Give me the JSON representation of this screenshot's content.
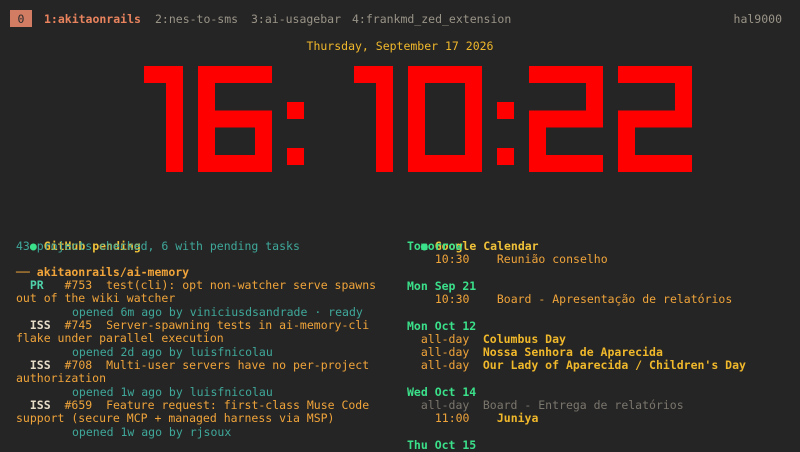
{
  "tmux": {
    "tabs": [
      {
        "label": "0"
      },
      {
        "label": "1:akitaonrails"
      },
      {
        "label": "2:nes-to-sms"
      },
      {
        "label": "3:ai-usagebar"
      },
      {
        "label": "4:frankmd_zed_extension"
      }
    ],
    "hostname": "hal9000"
  },
  "date_line": "Thursday, September 17 2026",
  "clock": {
    "text": "16:10:22",
    "color": "#ff0000"
  },
  "github": {
    "dot": "●",
    "title": "GitHub pending",
    "summary": "43 projects checked, 6 with pending tasks",
    "repo": "── akitaonrails/ai-memory",
    "items": [
      {
        "kind": "PR",
        "number": "#753",
        "title_1": "test(cli): opt non-watcher serve spawns",
        "title_2": "out of the wiki watcher",
        "meta": "opened 6m ago by viniciusdsandrade · ready"
      },
      {
        "kind": "ISS",
        "number": "#745",
        "title_1": "Server-spawning tests in ai-memory-cli",
        "title_2": "flake under parallel execution",
        "meta": "opened 2d ago by luisfnicolau"
      },
      {
        "kind": "ISS",
        "number": "#708",
        "title_1": "Multi-user servers have no per-project",
        "title_2": "authorization",
        "meta": "opened 1w ago by luisfnicolau"
      },
      {
        "kind": "ISS",
        "number": "#659",
        "title_1": "Feature request: first-class Muse Code",
        "title_2": "support (secure MCP + managed harness via MSP)",
        "meta": "opened 1w ago by rjsoux"
      }
    ]
  },
  "calendar": {
    "dot": "●",
    "title": "Google Calendar",
    "days": [
      {
        "date": "Tomorrow",
        "events": [
          {
            "time": "10:30",
            "title": "Reunião conselho"
          }
        ]
      },
      {
        "date": "Mon Sep 21",
        "events": [
          {
            "time": "10:30",
            "title": "Board - Apresentação de relatórios"
          }
        ]
      },
      {
        "date": "Mon Oct 12",
        "events": [
          {
            "time": "all-day",
            "title": "Columbus Day"
          },
          {
            "time": "all-day",
            "title": "Nossa Senhora de Aparecida"
          },
          {
            "time": "all-day",
            "title": "Our Lady of Aparecida / Children's Day"
          }
        ]
      },
      {
        "date": "Wed Oct 14",
        "events": [
          {
            "time": "all-day",
            "title": "Board - Entrega de relatórios"
          },
          {
            "time": "11:00",
            "title": "Juniya"
          }
        ]
      },
      {
        "date": "Thu Oct 15",
        "events": []
      }
    ]
  }
}
